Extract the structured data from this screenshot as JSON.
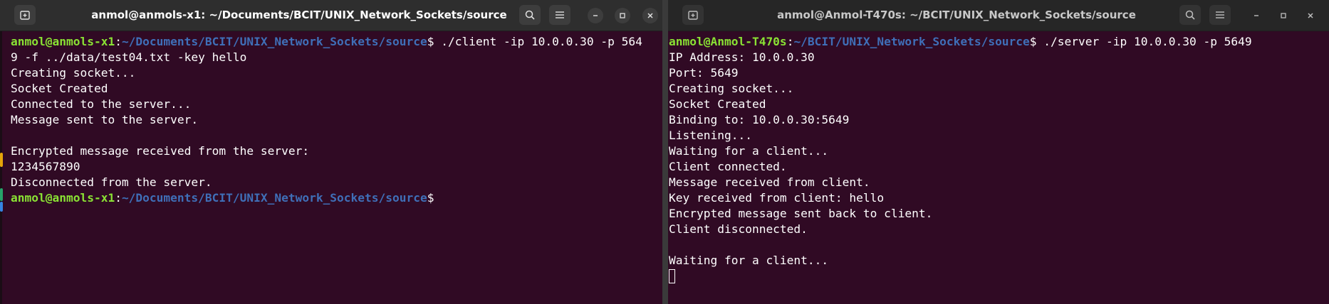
{
  "left_window": {
    "title": "anmol@anmols-x1: ~/Documents/BCIT/UNIX_Network_Sockets/source",
    "prompt_user": "anmol@anmols-x1",
    "prompt_colon": ":",
    "prompt_path": "~/Documents/BCIT/UNIX_Network_Sockets/source",
    "prompt_symbol": "$",
    "command_line1": " ./client -ip 10.0.0.30 -p 564",
    "command_line2": "9 -f ../data/test04.txt -key hello",
    "output": [
      "Creating socket...",
      "Socket Created",
      "Connected to the server...",
      "Message sent to the server.",
      "",
      "Encrypted message received from the server:",
      "1234567890",
      "Disconnected from the server."
    ]
  },
  "right_window": {
    "title": "anmol@Anmol-T470s: ~/BCIT/UNIX_Network_Sockets/source",
    "prompt_user": "anmol@Anmol-T470s",
    "prompt_colon": ":",
    "prompt_path": "~/BCIT/UNIX_Network_Sockets/source",
    "prompt_symbol": "$",
    "command": " ./server -ip 10.0.0.30 -p 5649",
    "output": [
      "IP Address: 10.0.0.30",
      "Port: 5649",
      "Creating socket...",
      "Socket Created",
      "Binding to: 10.0.0.30:5649",
      "Listening...",
      "Waiting for a client...",
      "Client connected.",
      "Message received from client.",
      "Key received from client: hello",
      "Encrypted message sent back to client.",
      "Client disconnected.",
      "",
      "Waiting for a client..."
    ]
  },
  "colors": {
    "terminal_bg": "#300a24",
    "prompt_user": "#8ae234",
    "prompt_path": "#3f6fb8",
    "titlebar": "#2e2e2e"
  },
  "icons": [
    "new-tab-icon",
    "search-icon",
    "menu-icon",
    "minimize-icon",
    "maximize-icon",
    "close-icon"
  ]
}
